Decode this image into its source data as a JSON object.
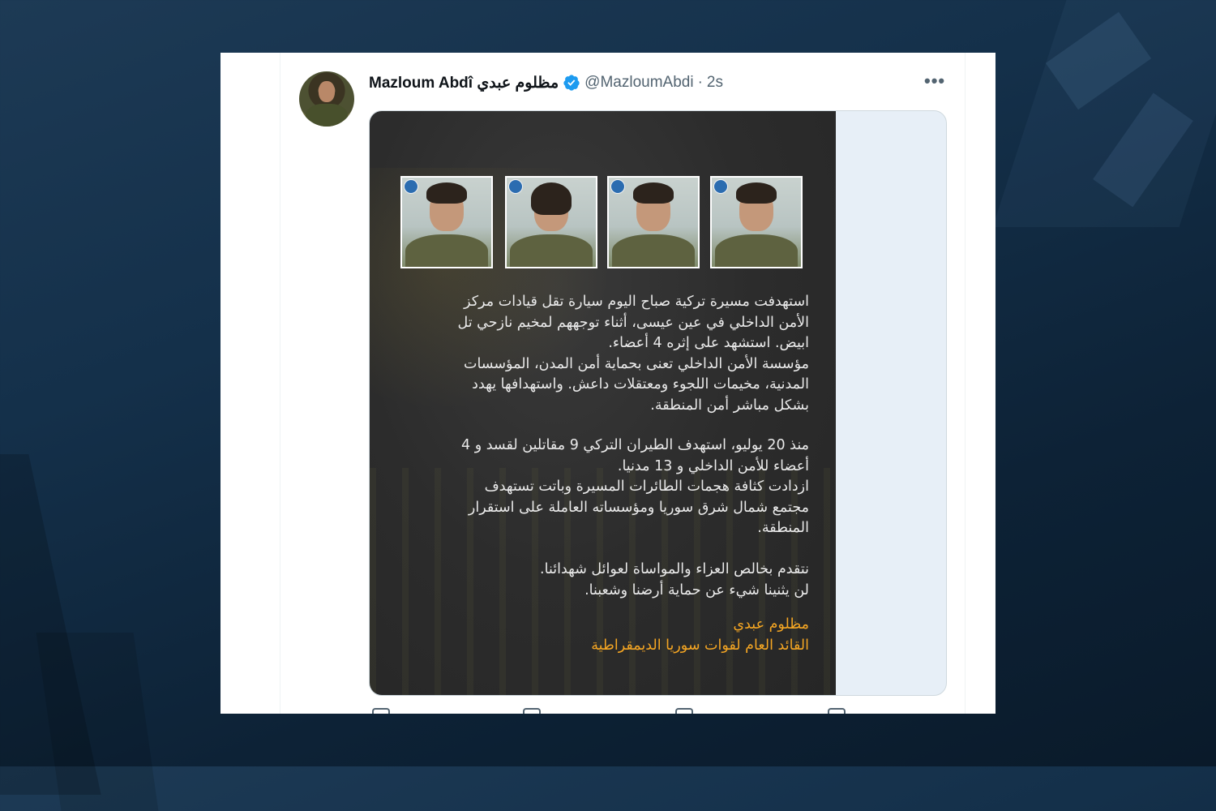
{
  "tweet": {
    "display_name": "Mazloum Abdî مظلوم عبدي",
    "handle": "@MazloumAbdi",
    "separator": "·",
    "timestamp": "2s",
    "more_label": "•••"
  },
  "poster": {
    "paragraph1": [
      "استهدفت مسيرة تركية صباح اليوم سيارة تقل قيادات مركز",
      "الأمن الداخلي في عين عيسى، أثناء توجههم لمخيم نازحي تل",
      "ابيض. استشهد على إثره 4 أعضاء.",
      "مؤسسة الأمن الداخلي تعنى بحماية أمن المدن، المؤسسات",
      "المدنية، مخيمات اللجوء ومعتقلات داعش. واستهدافها يهدد",
      "بشكل مباشر أمن المنطقة."
    ],
    "paragraph2": [
      "منذ 20 يوليو، استهدف الطيران التركي 9 مقاتلين لقسد و 4",
      "أعضاء للأمن الداخلي و 13 مدنيا.",
      "ازدادت كثافة هجمات الطائرات المسيرة وباتت تستهدف",
      "مجتمع شمال شرق سوريا ومؤسساته العاملة على استقرار",
      "المنطقة."
    ],
    "paragraph3": [
      "نتقدم بخالص العزاء والمواساة لعوائل شهدائنا.",
      "لن يثنينا شيء عن حماية أرضنا وشعبنا."
    ],
    "signature": [
      "مظلوم عبدي",
      "القائد العام لقوات سوريا الديمقراطية"
    ]
  },
  "colors": {
    "verified": "#1d9bf0",
    "signature": "#f5a623",
    "poster_bg": "#2c2c2c"
  }
}
